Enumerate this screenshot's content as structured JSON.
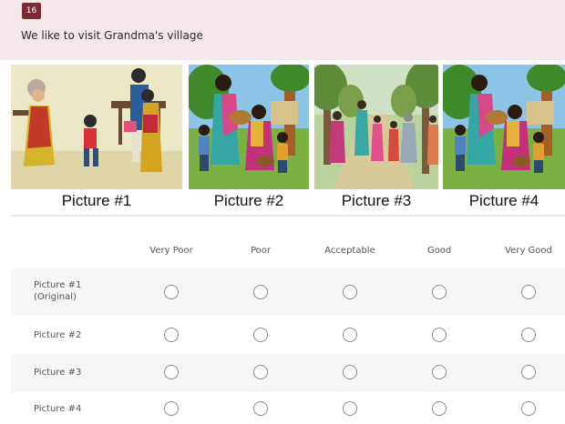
{
  "question": {
    "number": "16",
    "text": "We like to visit Grandma's village"
  },
  "pictures": [
    {
      "label": "Picture #1",
      "scene": "grandma-welcoming-family-illustration"
    },
    {
      "label": "Picture #2",
      "scene": "women-and-children-village-illustration"
    },
    {
      "label": "Picture #3",
      "scene": "family-walking-forest-path-illustration"
    },
    {
      "label": "Picture #4",
      "scene": "women-and-children-village-illustration"
    }
  ],
  "rating": {
    "columns": [
      "Very Poor",
      "Poor",
      "Acceptable",
      "Good",
      "Very Good"
    ],
    "rows": [
      {
        "label": "Picture #1\n(Original)"
      },
      {
        "label": "Picture #2"
      },
      {
        "label": "Picture #3"
      },
      {
        "label": "Picture #4"
      }
    ]
  },
  "colors": {
    "header_bg": "#f4e8ea",
    "number_badge": "#7a2a33",
    "row_shade": "#f6f6f6",
    "radio_border": "#8a8a8a"
  }
}
